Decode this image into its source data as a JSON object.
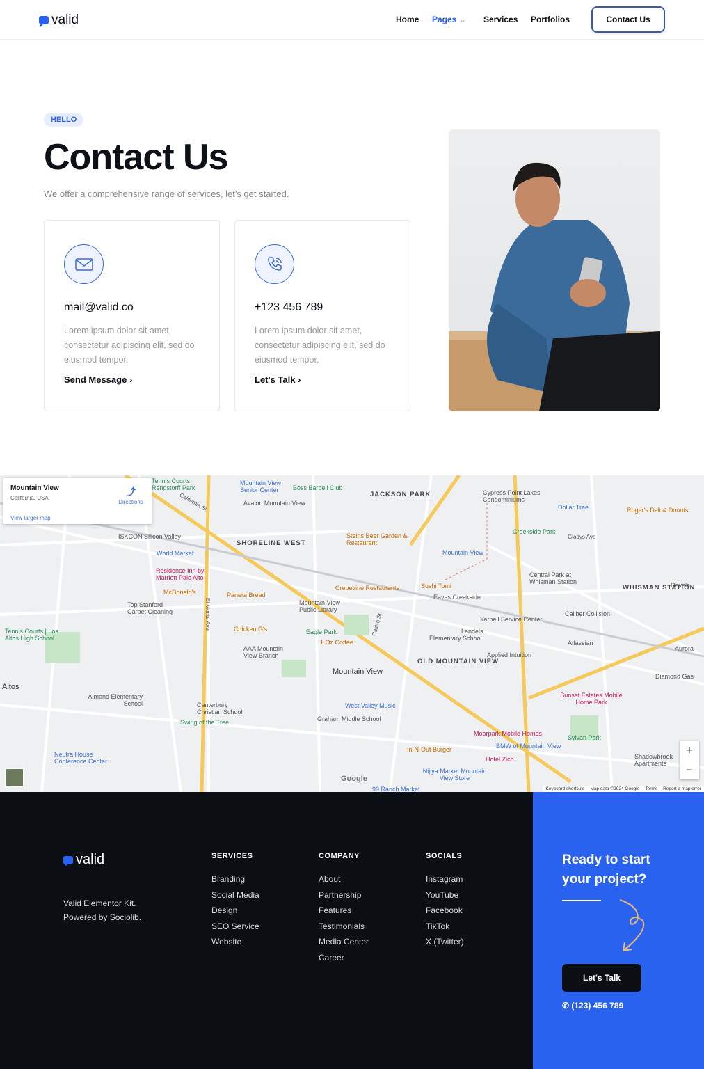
{
  "header": {
    "logo": "valid",
    "nav": [
      "Home",
      "Pages",
      "Services",
      "Portfolios"
    ],
    "contact_button": "Contact Us",
    "accent": "#2a62f0"
  },
  "hero": {
    "badge": "HELLO",
    "title": "Contact Us",
    "subtitle": "We offer a comprehensive range of services, let's get started."
  },
  "cards": [
    {
      "icon": "envelope-icon",
      "title": "mail@valid.co",
      "desc": "Lorem ipsum dolor sit amet, consectetur adipiscing elit, sed do eiusmod tempor.",
      "link": "Send Message"
    },
    {
      "icon": "phone-icon",
      "title": "+123 456 789",
      "desc": "Lorem ipsum dolor sit amet, consectetur adipiscing elit, sed do eiusmod tempor.",
      "link": "Let's Talk"
    }
  ],
  "map": {
    "place": "Mountain View",
    "region": "California, USA",
    "directions": "Directions",
    "larger": "View larger map",
    "footer": [
      "Keyboard shortcuts",
      "Map data ©2024 Google",
      "Terms",
      "Report a map error"
    ],
    "google": "Google",
    "labels": [
      "JACKSON PARK",
      "SHORELINE WEST",
      "OLD MOUNTAIN VIEW",
      "WHISMAN STATION",
      "Mountain View",
      "Altos",
      "ISKCON Silicon Valley",
      "World Market",
      "Residence Inn by Marriott Palo Alto",
      "McDonald's",
      "Panera Bread",
      "Top Stanford Carpet Cleaning",
      "Chicken G's",
      "Steins Beer Garden & Restaurant",
      "Crepevine Restaurants",
      "Sushi Tomi",
      "Mountain View Public Library",
      "Eagle Park",
      "1 Oz Coffee",
      "AAA Mountain View Branch",
      "West Valley Music",
      "Graham Middle School",
      "In-N-Out Burger",
      "Moorpark Mobile Homes",
      "BMW of Mountain View",
      "Hotel Zico",
      "Nijiya Market Mountain View Store",
      "Sunset Estates Mobile Home Park",
      "Sylvan Park",
      "Shadowbrook Apartments",
      "Dollar Tree",
      "Roger's Deli & Donuts",
      "Creekside Park",
      "Cypress Point Lakes Condominiums",
      "Yarnell Service Center",
      "Caliber Collision",
      "Atlassian",
      "Applied Intuition",
      "Elementary School",
      "Landels",
      "Central Park at Whisman Station",
      "Diamond Gas",
      "Aurora",
      "Revela",
      "Canterbury Christian School",
      "Swing of the Tree",
      "Almond Elementary School",
      "Neutra House Conference Center",
      "Tennis Courts | Los Altos High School",
      "Tennis Courts Rengstorff Park",
      "Mountain View Senior Center",
      "Boss Barbell Club",
      "Avalon Mountain View",
      "Eaves Creekside",
      "Mountain View",
      "Gladys Ave",
      "California St",
      "El Monte Ave",
      "Castro St",
      "99 Ranch Market"
    ]
  },
  "footer": {
    "logo": "valid",
    "tagline": "Valid Elementor Kit. Powered by Sociolib.",
    "columns": [
      {
        "title": "SERVICES",
        "items": [
          "Branding",
          "Social Media",
          "Design",
          "SEO Service",
          "Website"
        ]
      },
      {
        "title": "COMPANY",
        "items": [
          "About",
          "Partnership",
          "Features",
          "Testimonials",
          "Media Center",
          "Career"
        ]
      },
      {
        "title": "SOCIALS",
        "items": [
          "Instagram",
          "YouTube",
          "Facebook",
          "TikTok",
          "X (Twitter)"
        ]
      }
    ],
    "cta": {
      "title": "Ready to start your project?",
      "button": "Let's Talk",
      "phone": "(123) 456 789",
      "bg": "#2a62f0"
    }
  }
}
